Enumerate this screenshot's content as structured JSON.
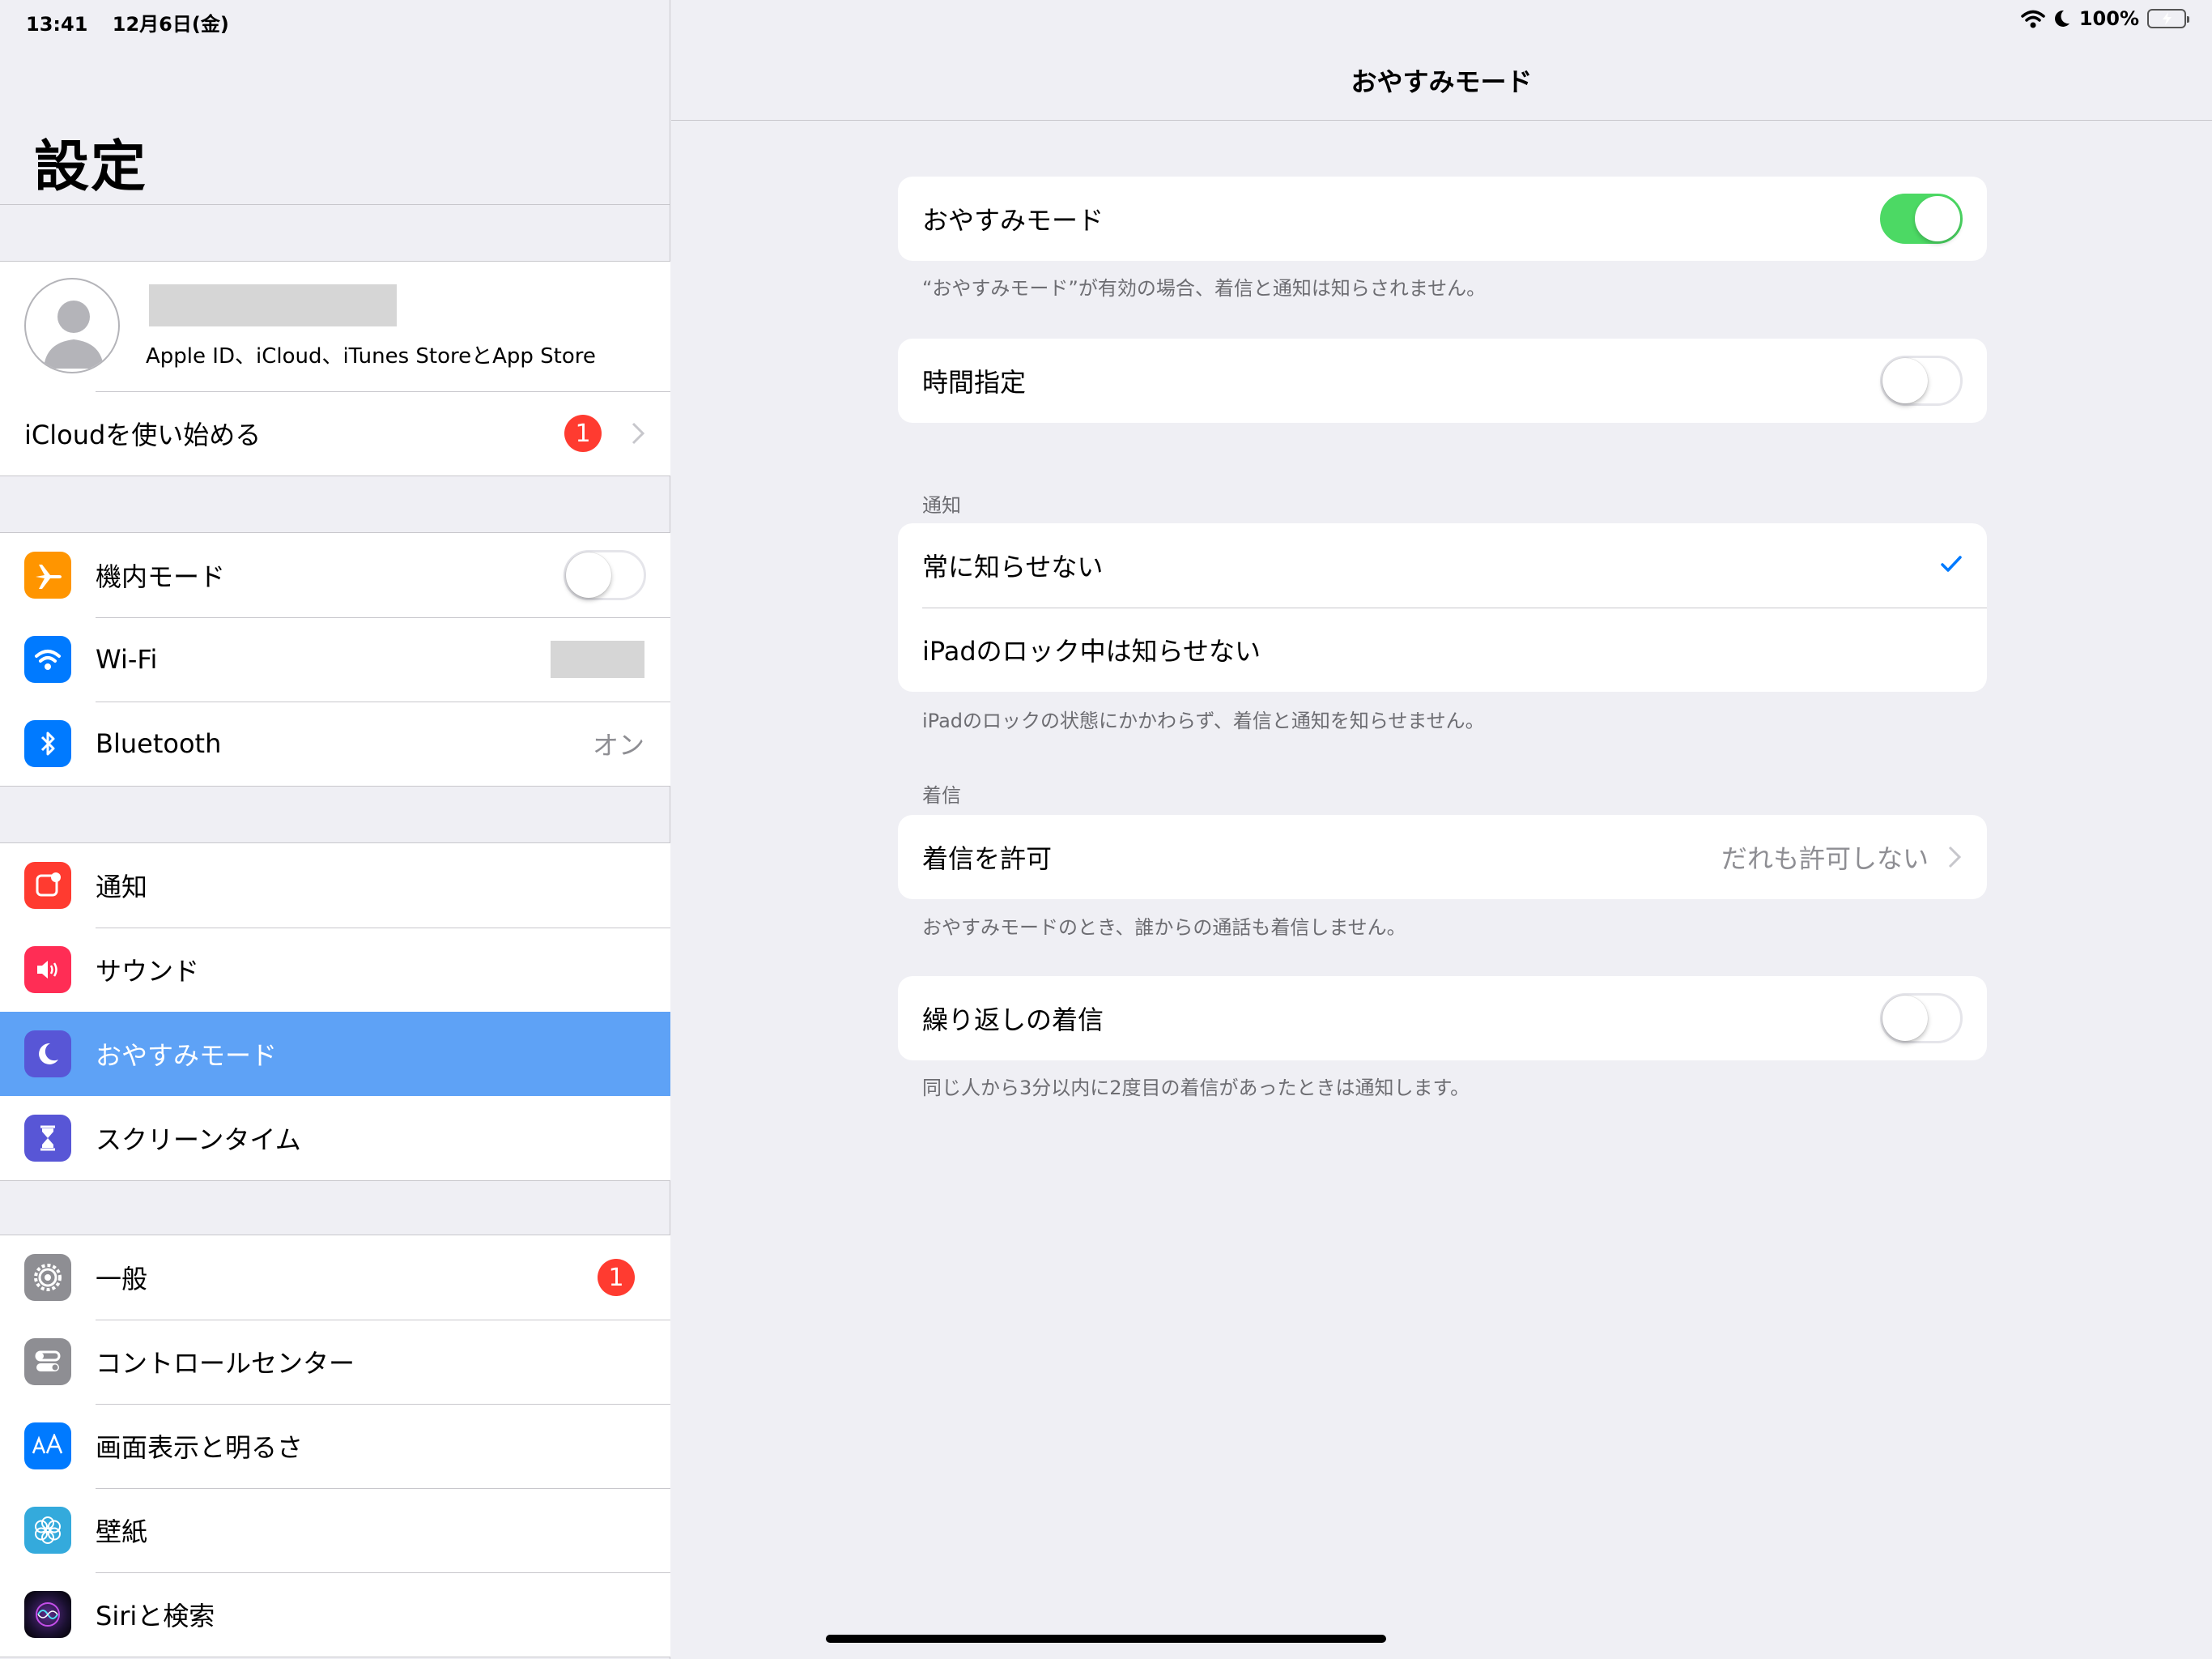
{
  "status_bar": {
    "time": "13:41",
    "date": "12月6日(金)",
    "battery": "100%"
  },
  "sidebar": {
    "title": "設定",
    "profile": {
      "subtitle": "Apple ID、iCloud、iTunes StoreとApp Store"
    },
    "icloud_row": {
      "label": "iCloudを使い始める",
      "badge": "1"
    },
    "group1": [
      {
        "label": "機内モード",
        "icon": "airplane-icon",
        "color": "#ff9500",
        "toggle": false
      },
      {
        "label": "Wi-Fi",
        "icon": "wifi-icon",
        "color": "#007aff"
      },
      {
        "label": "Bluetooth",
        "icon": "bluetooth-icon",
        "color": "#007aff",
        "value": "オン"
      }
    ],
    "group2": [
      {
        "label": "通知",
        "icon": "notifications-icon",
        "color": "#ff3b30"
      },
      {
        "label": "サウンド",
        "icon": "sound-icon",
        "color": "#ff2d55"
      },
      {
        "label": "おやすみモード",
        "icon": "moon-icon",
        "color": "#5856d6",
        "selected": true
      },
      {
        "label": "スクリーンタイム",
        "icon": "hourglass-icon",
        "color": "#5856d6"
      }
    ],
    "group3": [
      {
        "label": "一般",
        "icon": "gear-icon",
        "color": "#8e8e93",
        "badge": "1"
      },
      {
        "label": "コントロールセンター",
        "icon": "control-center-icon",
        "color": "#8e8e93"
      },
      {
        "label": "画面表示と明るさ",
        "icon": "display-icon",
        "color": "#007aff"
      },
      {
        "label": "壁紙",
        "icon": "wallpaper-icon",
        "color": "#34aadc"
      },
      {
        "label": "Siriと検索",
        "icon": "siri-icon",
        "color": "#222"
      }
    ]
  },
  "detail": {
    "title": "おやすみモード",
    "dnd": {
      "label": "おやすみモード",
      "on": true,
      "footer": "“おやすみモード”が有効の場合、着信と通知は知らされません。"
    },
    "scheduled": {
      "label": "時間指定",
      "on": false
    },
    "silence": {
      "header": "通知",
      "always": "常に知らせない",
      "locked": "iPadのロック中は知らせない",
      "footer": "iPadのロックの状態にかかわらず、着信と通知を知らせません。"
    },
    "phone": {
      "header": "着信",
      "allow_label": "着信を許可",
      "allow_value": "だれも許可しない",
      "footer": "おやすみモードのとき、誰からの通話も着信しません。"
    },
    "repeated": {
      "label": "繰り返しの着信",
      "on": false,
      "footer": "同じ人から3分以内に2度目の着信があったときは通知します。"
    }
  }
}
